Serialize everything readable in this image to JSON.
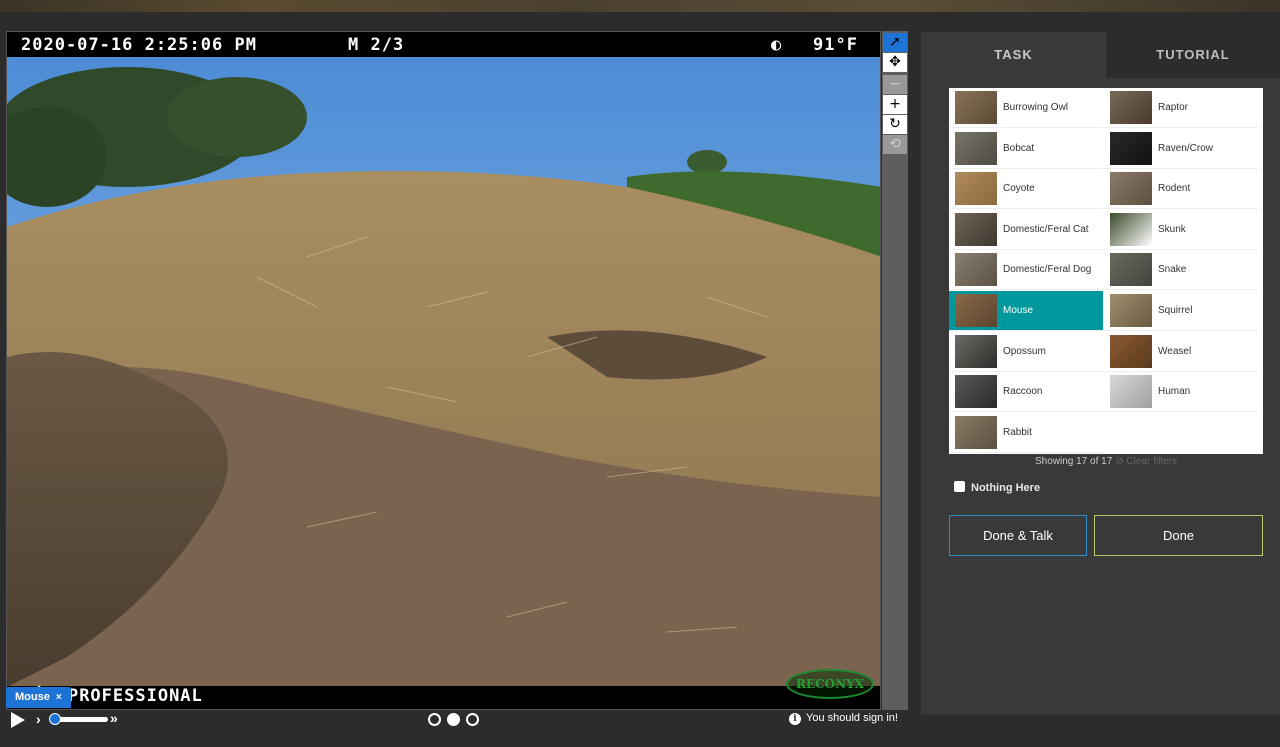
{
  "camera": {
    "timestamp": "2020-07-16 2:25:06 PM",
    "frame_info": "M 2/3",
    "moon": "◐",
    "temperature": "91°F",
    "model": "ᖷᓰᗝ PROFESSIONAL",
    "brand": "RECONYX"
  },
  "toolbar": {
    "pointer": "➚",
    "move": "✥",
    "zoom_out": "−",
    "zoom_in": "+",
    "rotate": "↻",
    "reset": "⟲"
  },
  "mark": {
    "label": "Mouse",
    "remove": "×"
  },
  "playback": {
    "fast_symbol": "»",
    "slow_symbol": "›"
  },
  "frames": {
    "total": 3,
    "current": 2
  },
  "signin": {
    "icon": "i",
    "text": "You should sign in!"
  },
  "tabs": {
    "task": "TASK",
    "tutorial": "TUTORIAL"
  },
  "choices": {
    "left": [
      {
        "label": "Burrowing Owl",
        "colors": [
          "#8a7358",
          "#5b4a36"
        ]
      },
      {
        "label": "Bobcat",
        "colors": [
          "#7a7468",
          "#4e4b45"
        ]
      },
      {
        "label": "Coyote",
        "colors": [
          "#b08a5a",
          "#8a6a40"
        ]
      },
      {
        "label": "Domestic/Feral Cat",
        "colors": [
          "#6e6456",
          "#3f3830"
        ]
      },
      {
        "label": "Domestic/Feral Dog",
        "colors": [
          "#8a8070",
          "#5a5246"
        ]
      },
      {
        "label": "Mouse",
        "colors": [
          "#8a6a48",
          "#5a4430"
        ]
      },
      {
        "label": "Opossum",
        "colors": [
          "#6a6a66",
          "#2e2e2c"
        ]
      },
      {
        "label": "Raccoon",
        "colors": [
          "#5a5a58",
          "#2a2a28"
        ]
      },
      {
        "label": "Rabbit",
        "colors": [
          "#8a7a66",
          "#5e5040"
        ]
      }
    ],
    "right": [
      {
        "label": "Raptor",
        "colors": [
          "#7a6a58",
          "#4a3a2c"
        ]
      },
      {
        "label": "Raven/Crow",
        "colors": [
          "#2a2a2c",
          "#111113"
        ]
      },
      {
        "label": "Rodent",
        "colors": [
          "#8a7a6a",
          "#5e5040"
        ]
      },
      {
        "label": "Skunk",
        "colors": [
          "#3a4a2a",
          "#ffffff"
        ]
      },
      {
        "label": "Snake",
        "colors": [
          "#6a6a60",
          "#44443c"
        ]
      },
      {
        "label": "Squirrel",
        "colors": [
          "#a09070",
          "#6a5a40"
        ]
      },
      {
        "label": "Weasel",
        "colors": [
          "#8a5a30",
          "#5a3a1e"
        ]
      },
      {
        "label": "Human",
        "colors": [
          "#d8d8d8",
          "#a0a0a0"
        ]
      }
    ],
    "selected": "Mouse"
  },
  "showing": {
    "text": "Showing 17 of 17",
    "clear": "⊘ Clear filters"
  },
  "nothing_here": "Nothing Here",
  "buttons": {
    "done_talk": "Done & Talk",
    "done": "Done"
  }
}
